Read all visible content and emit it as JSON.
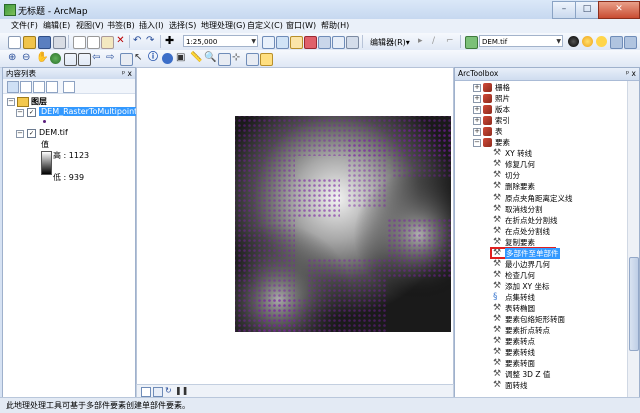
{
  "window": {
    "title": "无标题 - ArcMap",
    "minimize": "–",
    "maximize": "□",
    "close": "✕"
  },
  "menubar": [
    {
      "label": "文件(F)"
    },
    {
      "label": "编辑(E)"
    },
    {
      "label": "视图(V)"
    },
    {
      "label": "书签(B)"
    },
    {
      "label": "插入(I)"
    },
    {
      "label": "选择(S)"
    },
    {
      "label": "地理处理(G)"
    },
    {
      "label": "自定义(C)"
    },
    {
      "label": "窗口(W)"
    },
    {
      "label": "帮助(H)"
    }
  ],
  "toolbar": {
    "scale_value": "1:25,000",
    "editor_label": "编辑器(R)▾",
    "layer_combo": "DEM.tif"
  },
  "toc": {
    "title": "内容列表",
    "pin": "ᵖ x",
    "layers_group": "图层",
    "layer1": "DEM_RasterToMultipoint4",
    "layer2": "DEM.tif",
    "value_label": "值",
    "high": "高 : 1123",
    "low": "低 : 939"
  },
  "arctoolbox": {
    "title": "ArcToolbox",
    "close": "ᵖ x",
    "toolsets": [
      {
        "label": "栅格",
        "icon": "toolbox-icon",
        "expanded": false
      },
      {
        "label": "照片",
        "icon": "toolbox-icon",
        "expanded": false
      },
      {
        "label": "版本",
        "icon": "toolbox-icon",
        "expanded": false
      },
      {
        "label": "索引",
        "icon": "toolbox-icon",
        "expanded": false
      },
      {
        "label": "表",
        "icon": "toolbox-icon",
        "expanded": false
      },
      {
        "label": "要素",
        "icon": "toolbox-icon",
        "expanded": true
      }
    ],
    "tools": [
      {
        "label": "XY 转线",
        "icon": "hammer-icon"
      },
      {
        "label": "修复几何",
        "icon": "hammer-icon"
      },
      {
        "label": "切分",
        "icon": "hammer-icon"
      },
      {
        "label": "删除要素",
        "icon": "hammer-icon"
      },
      {
        "label": "原点夹角距离定义线",
        "icon": "hammer-icon"
      },
      {
        "label": "取消线分割",
        "icon": "hammer-icon"
      },
      {
        "label": "在折点处分割线",
        "icon": "hammer-icon"
      },
      {
        "label": "在点处分割线",
        "icon": "hammer-icon"
      },
      {
        "label": "复制要素",
        "icon": "hammer-icon"
      },
      {
        "label": "多部件至单部件",
        "icon": "hammer-icon",
        "highlighted": true
      },
      {
        "label": "最小边界几何",
        "icon": "hammer-icon"
      },
      {
        "label": "检查几何",
        "icon": "hammer-icon"
      },
      {
        "label": "添加 XY 坐标",
        "icon": "hammer-icon"
      },
      {
        "label": "点集转线",
        "icon": "script-icon"
      },
      {
        "label": "表转椭圆",
        "icon": "hammer-icon"
      },
      {
        "label": "要素包络矩形转面",
        "icon": "hammer-icon"
      },
      {
        "label": "要素折点转点",
        "icon": "hammer-icon"
      },
      {
        "label": "要素转点",
        "icon": "hammer-icon"
      },
      {
        "label": "要素转线",
        "icon": "hammer-icon"
      },
      {
        "label": "要素转面",
        "icon": "hammer-icon"
      },
      {
        "label": "调整 3D Z 值",
        "icon": "hammer-icon"
      },
      {
        "label": "面转线",
        "icon": "hammer-icon"
      }
    ]
  },
  "statusbar": {
    "text": "此地理处理工具可基于多部件要素创建单部件要素。"
  },
  "colors": {
    "point_purple": "#7a1fa2",
    "highlight": "#e02020"
  }
}
